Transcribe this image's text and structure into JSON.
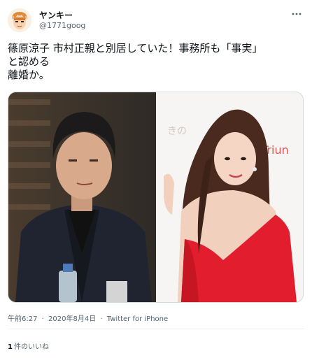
{
  "user": {
    "name": "ヤンキー",
    "handle": "@1771goog"
  },
  "tweet": {
    "lines": [
      "篠原涼子 市村正親と別居していた！事務所も「事実」",
      "と認める",
      "離婚か。"
    ]
  },
  "media": {
    "right_photo_text": "Triun"
  },
  "meta": {
    "time": "午前6:27",
    "separator": "·",
    "date": "2020年8月4日",
    "source": "Twitter for iPhone"
  },
  "likes": {
    "count": "1",
    "label": "件のいいね"
  },
  "colors": {
    "text": "#0f1419",
    "secondary": "#536471",
    "border": "#cfd9de"
  }
}
